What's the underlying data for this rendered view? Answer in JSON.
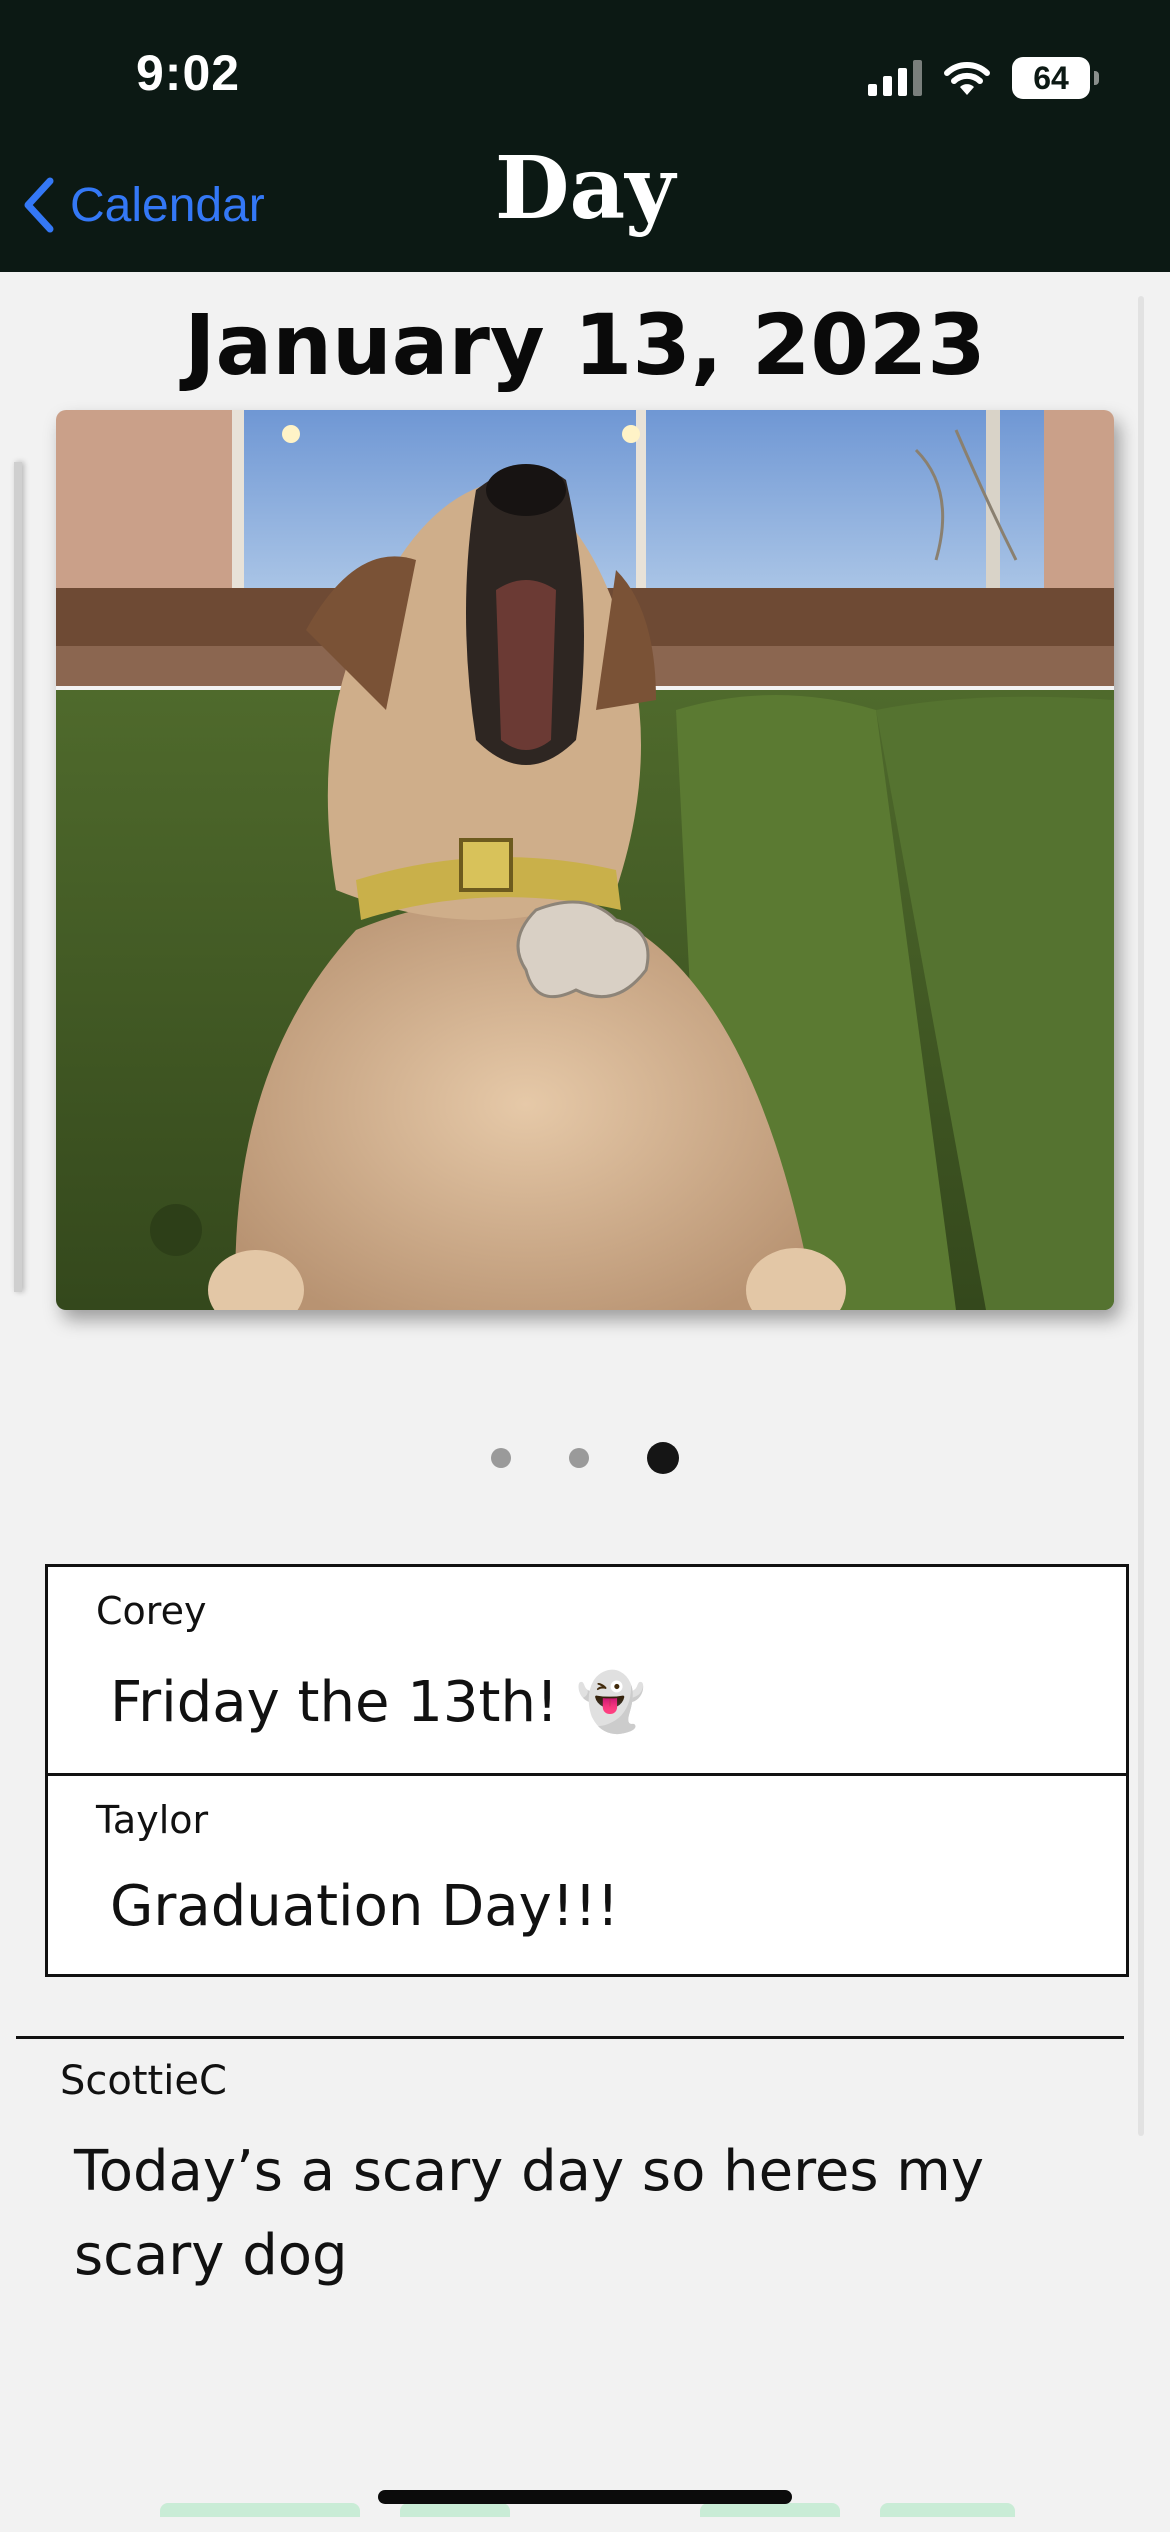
{
  "status_bar": {
    "time": "9:02",
    "battery": "64"
  },
  "nav": {
    "back_label": "Calendar",
    "title": "Day"
  },
  "day": {
    "date": "January 13, 2023"
  },
  "carousel": {
    "page_count": 3,
    "current_page": 3
  },
  "events": [
    {
      "author": "Corey",
      "text": "Friday the 13th! 👻"
    },
    {
      "author": "Taylor",
      "text": "Graduation Day!!!"
    }
  ],
  "post": {
    "author": "ScottieC",
    "text": "Today’s a scary day so heres my scary dog"
  },
  "colors": {
    "nav_background": "#0c1914",
    "accent": "#3478f6",
    "page_background": "#f2f2f2"
  }
}
